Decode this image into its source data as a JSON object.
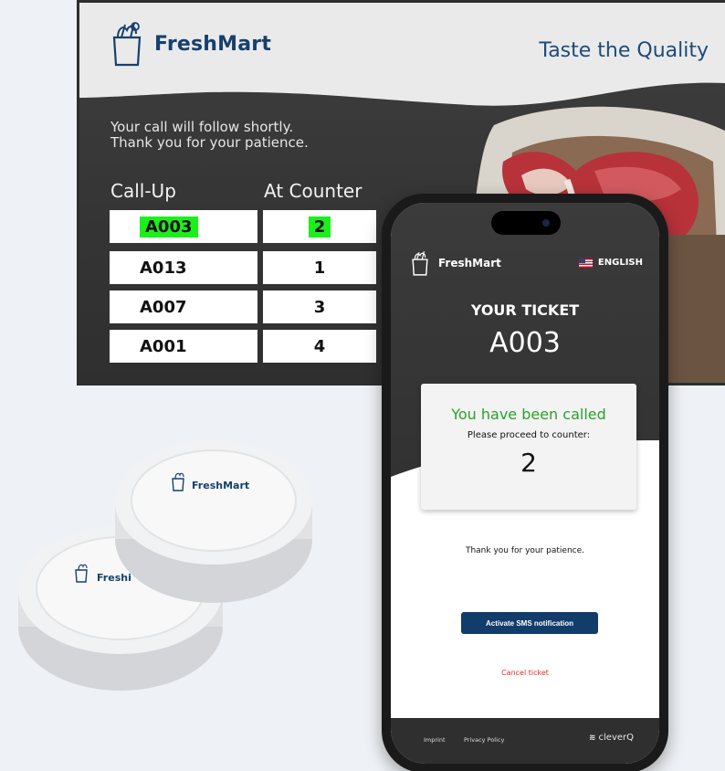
{
  "display": {
    "brand": "FreshMart",
    "tagline": "Taste the Quality",
    "notice_line1": "Your call will follow shortly.",
    "notice_line2": "Thank you for your patience.",
    "col_callup": "Call-Up",
    "col_counter": "At Counter",
    "highlight_color": "#1bf01b",
    "queue": [
      {
        "ticket": "A003",
        "counter": "2",
        "highlighted": true
      },
      {
        "ticket": "A013",
        "counter": "1",
        "highlighted": false
      },
      {
        "ticket": "A007",
        "counter": "3",
        "highlighted": false
      },
      {
        "ticket": "A001",
        "counter": "4",
        "highlighted": false
      }
    ]
  },
  "pucks": {
    "brand_front": "FreshMart",
    "brand_back": "Freshi"
  },
  "phone": {
    "brand": "FreshMart",
    "language": "ENGLISH",
    "your_ticket_label": "YOUR TICKET",
    "ticket_number": "A003",
    "called_title": "You have been called",
    "proceed_text": "Please proceed to counter:",
    "counter_number": "2",
    "thanks_text": "Thank you for your patience.",
    "sms_button": "Activate SMS notification",
    "cancel_link": "Cancel ticket",
    "footer_imprint": "Imprint",
    "footer_privacy": "Privacy Policy",
    "footer_brand": "cleverQ"
  },
  "colors": {
    "brand_navy": "#16406d",
    "called_green": "#2aa12a",
    "cancel_red": "#e02a2a",
    "button_navy": "#123c6a"
  }
}
